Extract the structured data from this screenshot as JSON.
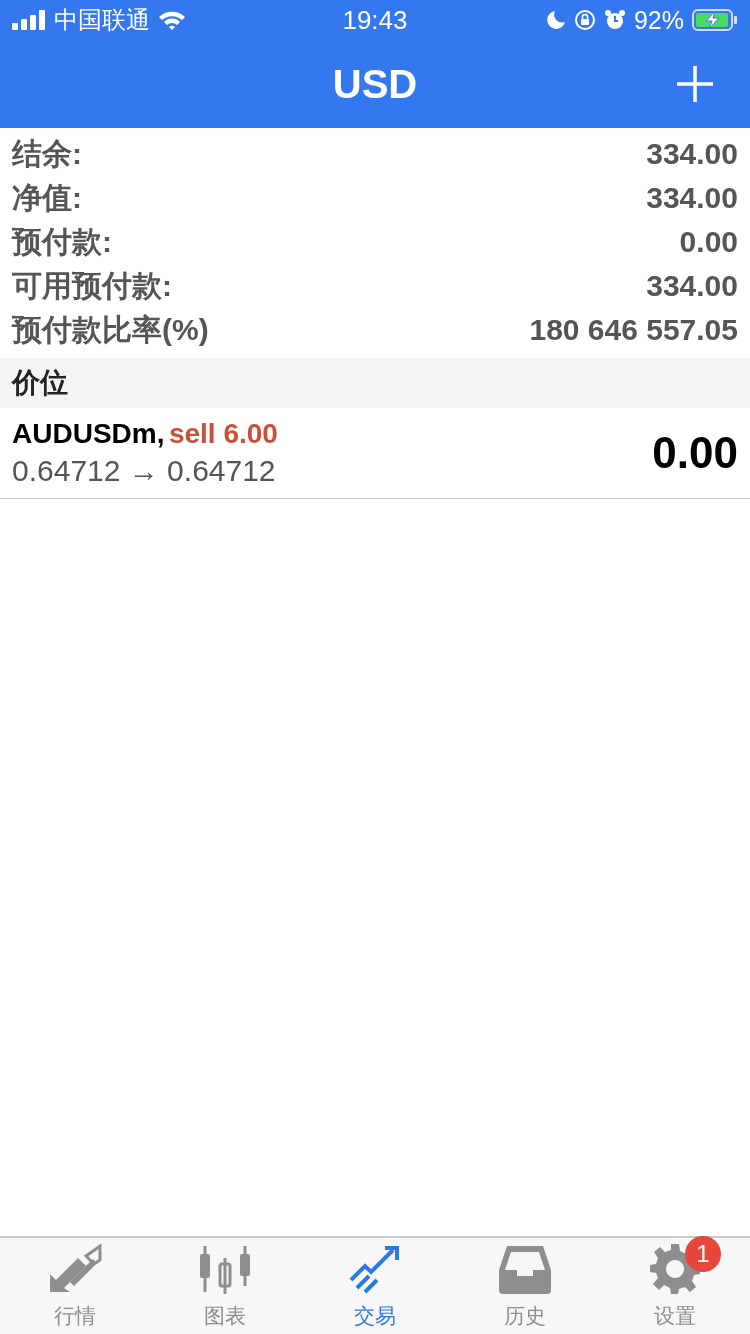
{
  "status_bar": {
    "carrier": "中国联通",
    "time": "19:43",
    "battery_percent": "92%",
    "charging": true
  },
  "header": {
    "title": "USD"
  },
  "summary": [
    {
      "label": "结余:",
      "value": "334.00"
    },
    {
      "label": "净值:",
      "value": "334.00"
    },
    {
      "label": "预付款:",
      "value": "0.00"
    },
    {
      "label": "可用预付款:",
      "value": "334.00"
    },
    {
      "label": "预付款比率(%)",
      "value": "180 646 557.05"
    }
  ],
  "section": {
    "title": "价位"
  },
  "positions": [
    {
      "symbol": "AUDUSDm,",
      "side": "sell 6.00",
      "prices": "0.64712 → 0.64712",
      "profit": "0.00"
    }
  ],
  "tab_bar": [
    {
      "label": "行情",
      "kind": "quotes",
      "selected": false
    },
    {
      "label": "图表",
      "kind": "chart",
      "selected": false
    },
    {
      "label": "交易",
      "kind": "trade",
      "selected": true
    },
    {
      "label": "历史",
      "kind": "history",
      "selected": false
    },
    {
      "label": "设置",
      "kind": "settings",
      "selected": false,
      "badge": "1"
    }
  ]
}
